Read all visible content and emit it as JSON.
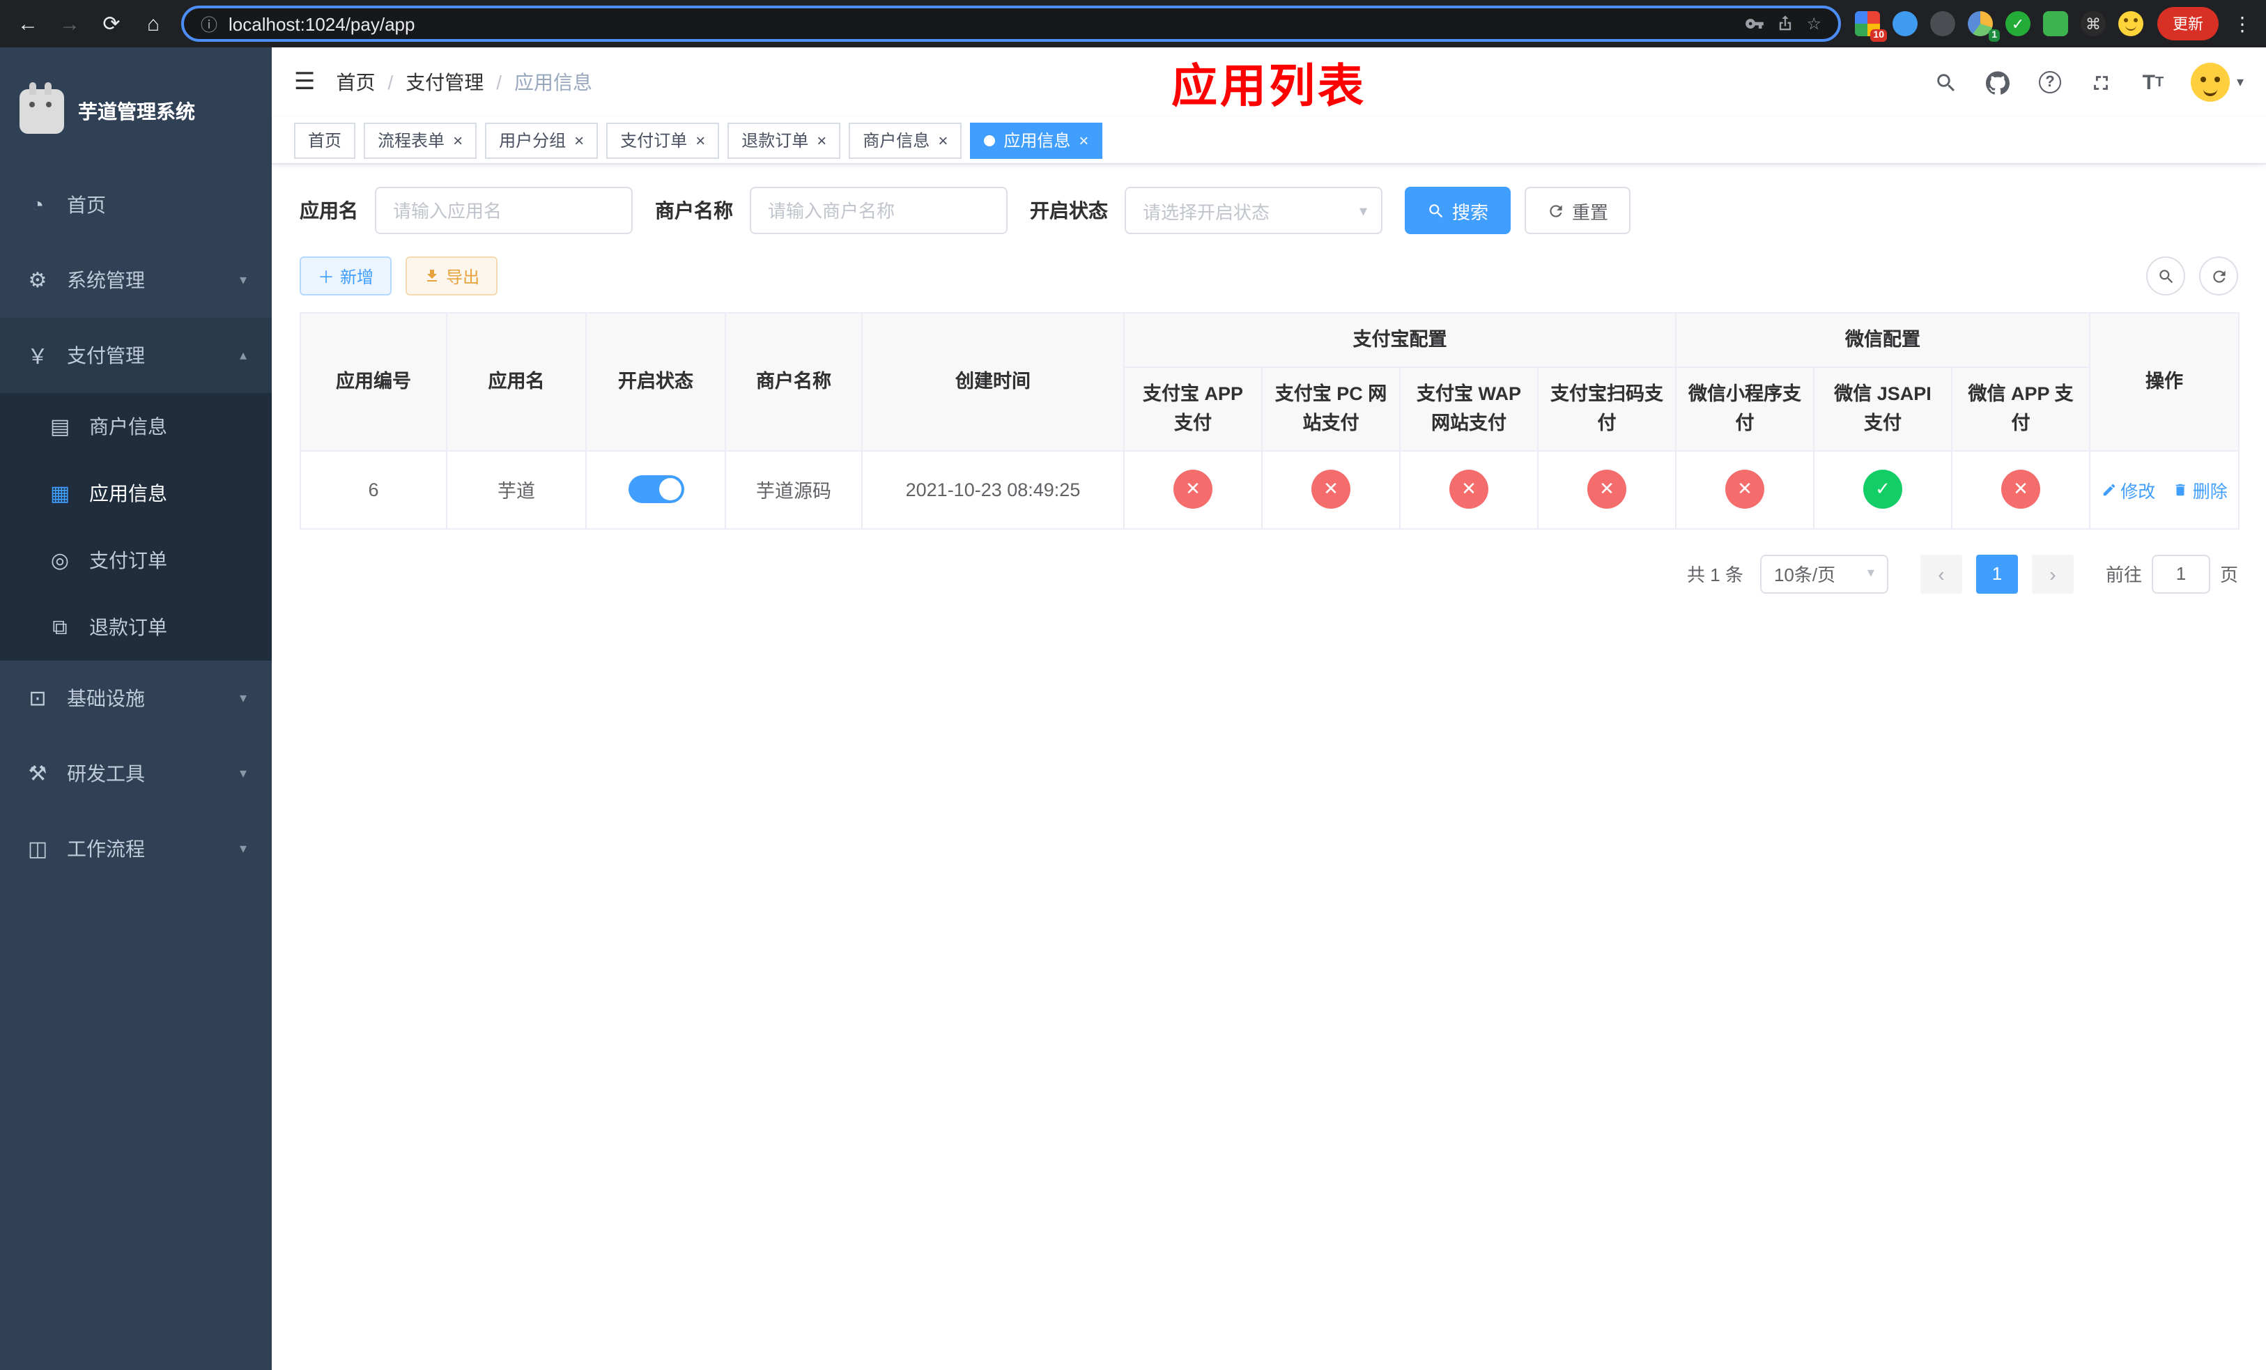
{
  "browser": {
    "url": "localhost:1024/pay/app",
    "update_label": "更新",
    "ext_badges": {
      "grid": "10",
      "avatar": "1"
    }
  },
  "sidebar": {
    "app_title": "芋道管理系统",
    "items": [
      {
        "label": "首页"
      },
      {
        "label": "系统管理"
      },
      {
        "label": "支付管理"
      },
      {
        "label": "基础设施"
      },
      {
        "label": "研发工具"
      },
      {
        "label": "工作流程"
      }
    ],
    "payment_children": [
      {
        "label": "商户信息"
      },
      {
        "label": "应用信息"
      },
      {
        "label": "支付订单"
      },
      {
        "label": "退款订单"
      }
    ]
  },
  "header": {
    "breadcrumb": [
      "首页",
      "支付管理",
      "应用信息"
    ],
    "page_title": "应用列表"
  },
  "tabs": [
    {
      "label": "首页"
    },
    {
      "label": "流程表单"
    },
    {
      "label": "用户分组"
    },
    {
      "label": "支付订单"
    },
    {
      "label": "退款订单"
    },
    {
      "label": "商户信息"
    },
    {
      "label": "应用信息"
    }
  ],
  "filters": {
    "app_name_label": "应用名",
    "app_name_placeholder": "请输入应用名",
    "merchant_label": "商户名称",
    "merchant_placeholder": "请输入商户名称",
    "status_label": "开启状态",
    "status_placeholder": "请选择开启状态",
    "search_label": "搜索",
    "reset_label": "重置"
  },
  "toolbar": {
    "add_label": "新增",
    "export_label": "导出"
  },
  "table": {
    "groups": {
      "alipay": "支付宝配置",
      "wechat": "微信配置"
    },
    "columns": {
      "id": "应用编号",
      "name": "应用名",
      "status": "开启状态",
      "merchant": "商户名称",
      "created": "创建时间",
      "ops": "操作"
    },
    "config_columns": [
      "支付宝 APP 支付",
      "支付宝 PC 网站支付",
      "支付宝 WAP 网站支付",
      "支付宝扫码支付",
      "微信小程序支付",
      "微信 JSAPI 支付",
      "微信 APP 支付"
    ],
    "row": {
      "id": "6",
      "name": "芋道",
      "enabled": true,
      "merchant": "芋道源码",
      "created": "2021-10-23 08:49:25",
      "statuses": [
        "cross",
        "cross",
        "cross",
        "cross",
        "cross",
        "check",
        "cross"
      ],
      "edit_label": "修改",
      "delete_label": "删除"
    }
  },
  "pagination": {
    "total_text": "共 1 条",
    "page_size_text": "10条/页",
    "current_page": "1",
    "goto_label": "前往",
    "goto_value": "1",
    "goto_unit": "页"
  },
  "colors": {
    "accent": "#409eff",
    "danger": "#f56c6c",
    "success": "#13ce66",
    "title_red": "#ff0000",
    "sidebar_bg": "#304156",
    "submenu_bg": "#1f2d3d"
  },
  "icons": {
    "back": "←",
    "forward": "→",
    "reload": "⟳",
    "home": "⌂",
    "info": "ⓘ",
    "star": "☆",
    "menu_dots": "⋮",
    "hamburger": "☰",
    "breadcrumb_sep": "/",
    "chevron_down": "▾",
    "chevron_up": "▴",
    "close": "×",
    "caret_down": "▾",
    "question": "?",
    "plus": "＋",
    "prev": "‹",
    "next": "›",
    "check_glyph": "✓",
    "knot": "⌘",
    "green_check": "✓",
    "dashboard": "◔",
    "gear": "⚙",
    "yen": "￥",
    "card": "▤",
    "grid": "▦",
    "order": "◎",
    "refund": "⧉",
    "infra": "⊡",
    "tools": "⚒",
    "workflow": "◫",
    "font_big": "T",
    "font_small": "T"
  }
}
